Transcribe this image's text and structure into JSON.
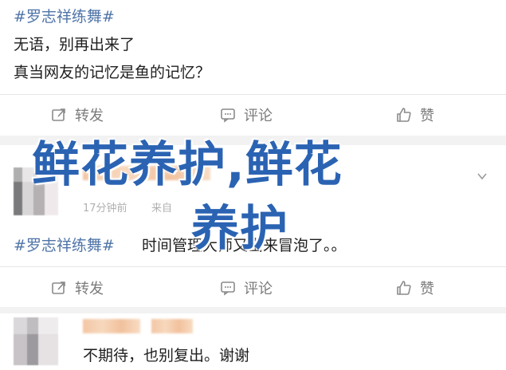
{
  "posts": [
    {
      "hashtag": "#罗志祥练舞#",
      "lines": [
        "无语，别再出来了",
        "真当网友的记忆是鱼的记忆？"
      ]
    },
    {
      "time_text": "17分钟前",
      "source_text": "来自",
      "hashtag": "#罗志祥练舞#",
      "text": "时间管理大师又出来冒泡了。。"
    },
    {
      "text": "不期待，也别复出。谢谢"
    }
  ],
  "actions": {
    "repost_label": "转发",
    "comment_label": "评论",
    "like_label": "赞"
  },
  "overlay": {
    "line1": "鲜花养护,鲜花",
    "line2": "养护",
    "color": "#2b63b3"
  },
  "icons": [
    "repost-icon",
    "comment-icon",
    "like-icon",
    "chevron-down-icon"
  ]
}
